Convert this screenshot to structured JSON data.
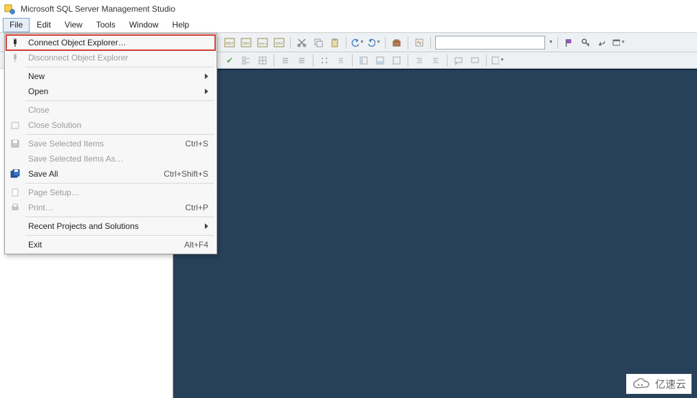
{
  "title": "Microsoft SQL Server Management Studio",
  "menubar": {
    "file": "File",
    "edit": "Edit",
    "view": "View",
    "tools": "Tools",
    "window": "Window",
    "help": "Help"
  },
  "toolbar": {
    "search_placeholder": ""
  },
  "file_menu": {
    "connect_object_explorer": "Connect Object Explorer…",
    "disconnect_object_explorer": "Disconnect Object Explorer",
    "new": "New",
    "open": "Open",
    "close": "Close",
    "close_solution": "Close Solution",
    "save_selected": "Save Selected Items",
    "save_selected_shortcut": "Ctrl+S",
    "save_selected_as": "Save Selected Items As…",
    "save_all": "Save All",
    "save_all_shortcut": "Ctrl+Shift+S",
    "page_setup": "Page Setup…",
    "print": "Print…",
    "print_shortcut": "Ctrl+P",
    "recent": "Recent Projects and Solutions",
    "exit": "Exit",
    "exit_shortcut": "Alt+F4"
  },
  "watermark": "亿速云"
}
